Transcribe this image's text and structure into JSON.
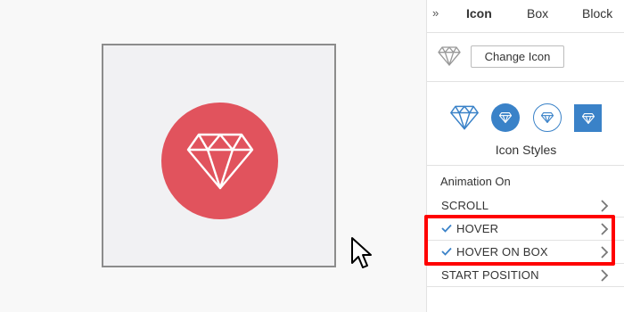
{
  "panel": {
    "tab_toggle": "»",
    "tabs": [
      {
        "label": "Icon",
        "active": true
      },
      {
        "label": "Box",
        "active": false
      },
      {
        "label": "Block",
        "active": false
      }
    ],
    "current_icon": "diamond-icon",
    "change_icon_label": "Change Icon",
    "icon_styles": [
      {
        "name": "plain"
      },
      {
        "name": "filled-circle"
      },
      {
        "name": "outlined-circle"
      },
      {
        "name": "filled-square"
      }
    ],
    "icon_styles_label": "Icon Styles",
    "animation_title": "Animation On",
    "animation_items": [
      {
        "label": "SCROLL",
        "checked": false
      },
      {
        "label": "HOVER",
        "checked": true
      },
      {
        "label": "HOVER ON BOX",
        "checked": true
      },
      {
        "label": "START POSITION",
        "checked": false
      }
    ]
  },
  "colors": {
    "icon_circle": "#e1535d",
    "accent": "#3a82c8",
    "highlight": "#ff0000"
  }
}
